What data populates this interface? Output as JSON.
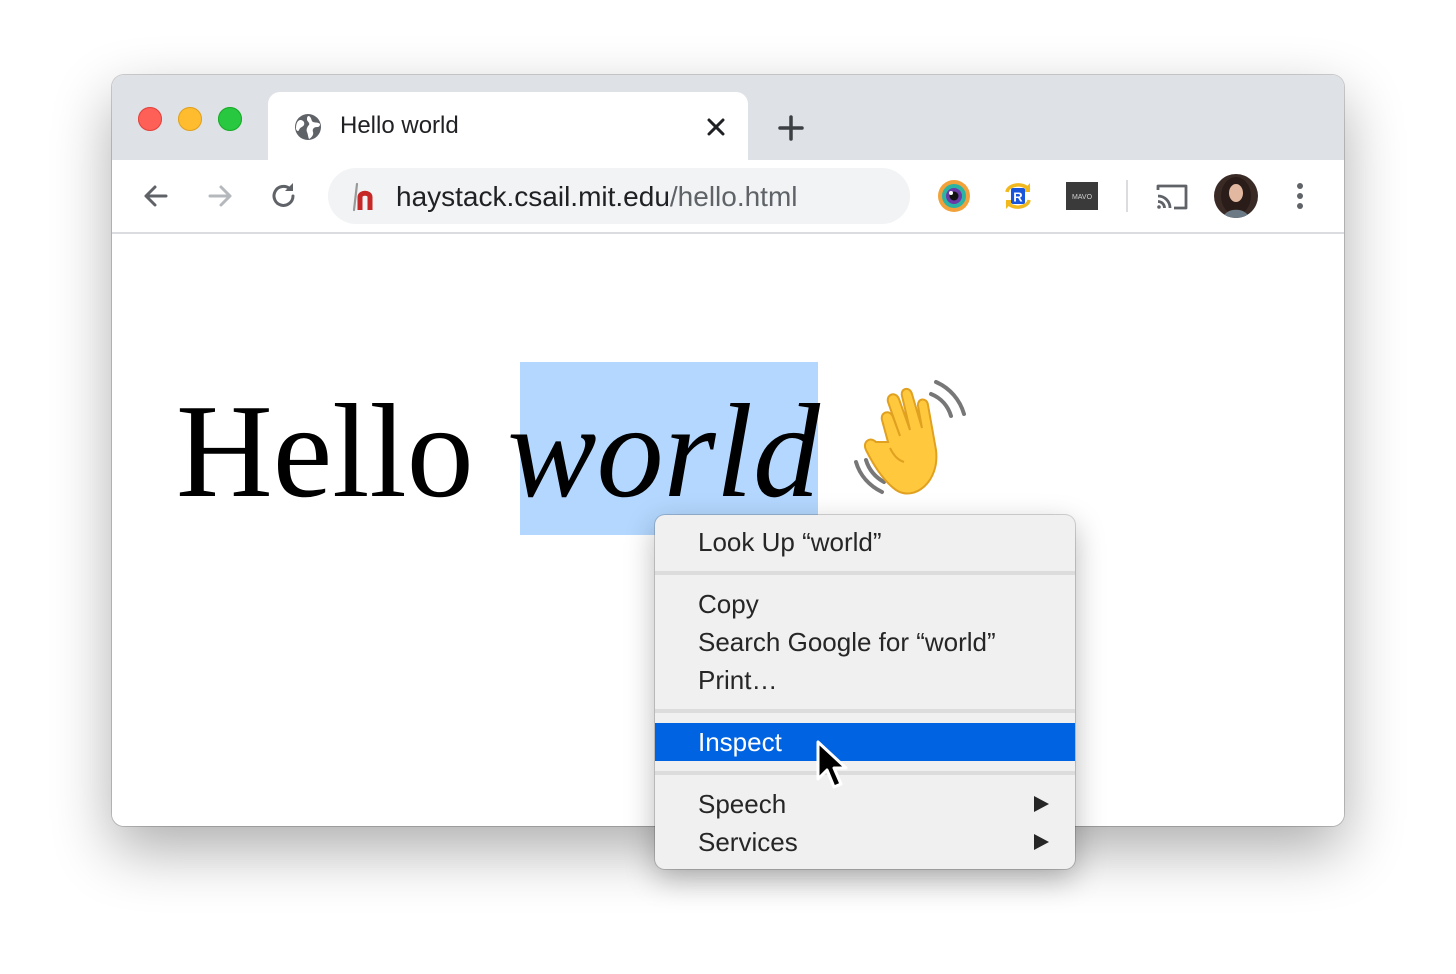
{
  "browser": {
    "tab": {
      "title": "Hello world"
    },
    "address": {
      "host": "haystack.csail.mit.edu",
      "path": "/hello.html"
    },
    "icons": {
      "traffic_lights": [
        "close",
        "minimize",
        "zoom"
      ],
      "tab_favicon": "globe-icon",
      "tab_close": "close-icon",
      "new_tab": "plus-icon",
      "back": "arrow-left-icon",
      "forward": "arrow-right-icon",
      "reload": "reload-icon",
      "site_icon": "haystack-icon",
      "extensions": [
        "eye-extension-icon",
        "refresh-r-extension-icon",
        "mavo-extension-icon"
      ],
      "cast": "cast-icon",
      "profile": "avatar",
      "menu": "more-vertical-icon"
    },
    "extension_labels": {
      "mavo": "MAVO"
    },
    "colors": {
      "tab_strip": "#dee1e6",
      "selection": "#b3d7fe",
      "menu_highlight": "#0063e1"
    }
  },
  "page": {
    "heading_plain": "Hello",
    "heading_selected": "world",
    "emoji": "waving-hand-icon"
  },
  "context_menu": {
    "items": [
      {
        "label": "Look Up “world”"
      },
      {
        "label": "Copy"
      },
      {
        "label": "Search Google for “world”"
      },
      {
        "label": "Print…"
      },
      {
        "label": "Inspect",
        "highlighted": true
      },
      {
        "label": "Speech",
        "submenu": true
      },
      {
        "label": "Services",
        "submenu": true
      }
    ]
  }
}
